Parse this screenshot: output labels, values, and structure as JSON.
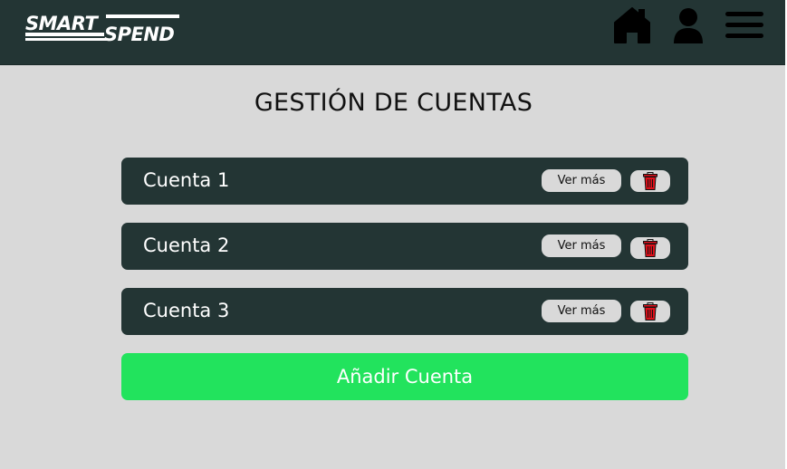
{
  "app": {
    "logo_text": "SMARTSPEND",
    "logo_part1": "SMART",
    "logo_part2": "SPEND"
  },
  "nav": {
    "icons": [
      "home-icon",
      "user-icon",
      "hamburger-menu-icon"
    ]
  },
  "page": {
    "title": "GESTIÓN DE CUENTAS"
  },
  "accounts": [
    {
      "name": "Cuenta 1",
      "details_label": "Ver más",
      "delete_icon": "trash-icon"
    },
    {
      "name": "Cuenta 2",
      "details_label": "Ver más",
      "delete_icon": "trash-icon"
    },
    {
      "name": "Cuenta 3",
      "details_label": "Ver más",
      "delete_icon": "trash-icon"
    }
  ],
  "actions": {
    "add_account_label": "Añadir Cuenta"
  },
  "colors": {
    "header_bg": "#233534",
    "page_bg": "#d9d9d9",
    "row_bg": "#233534",
    "pill_bg": "#d9d9d9",
    "accent_green": "#22e35d",
    "delete_red": "#e0101a"
  }
}
